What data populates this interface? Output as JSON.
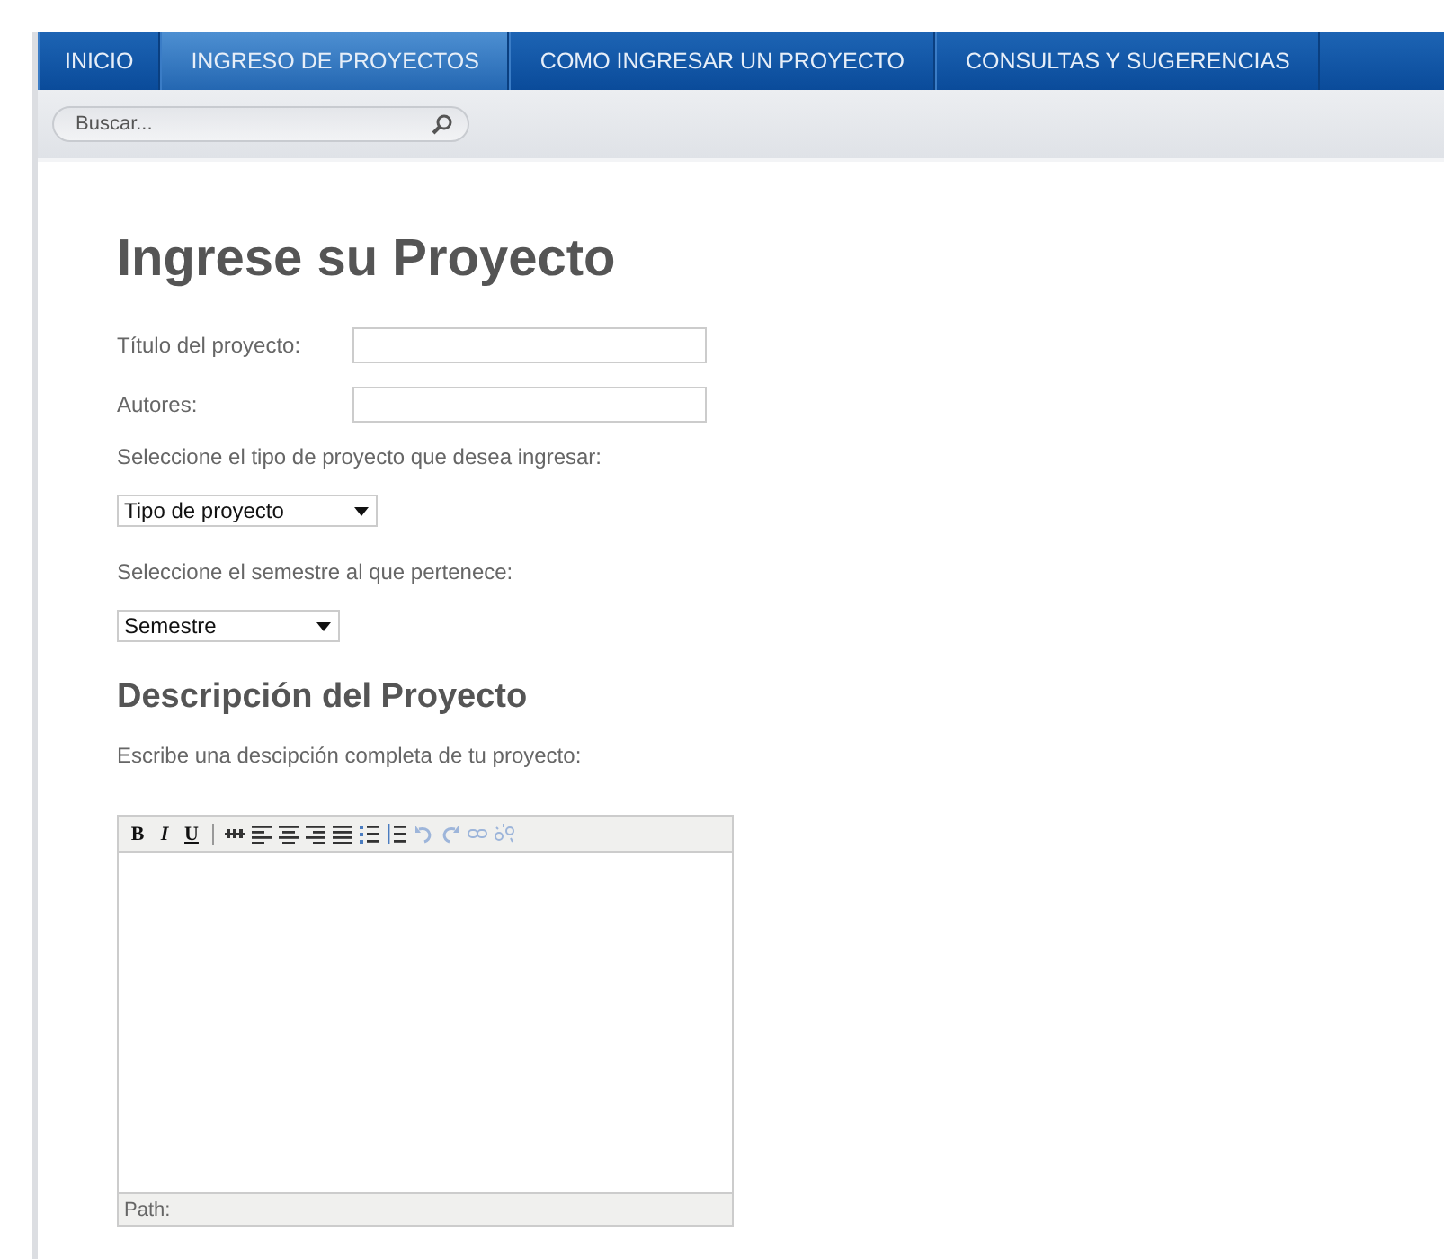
{
  "nav": {
    "items": [
      {
        "label": "INICIO",
        "selected": false
      },
      {
        "label": "INGRESO DE PROYECTOS",
        "selected": true
      },
      {
        "label": "COMO INGRESAR UN PROYECTO",
        "selected": false
      },
      {
        "label": "CONSULTAS Y SUGERENCIAS",
        "selected": false
      }
    ]
  },
  "search": {
    "placeholder": "Buscar..."
  },
  "form": {
    "title": "Ingrese su Proyecto",
    "fields": [
      {
        "label": "Título del proyecto:"
      },
      {
        "label": "Autores:"
      }
    ],
    "type_prompt": "Seleccione el tipo de proyecto que desea ingresar:",
    "type_select": {
      "value": "Tipo de proyecto"
    },
    "semester_prompt": "Seleccione el semestre al que pertenece:",
    "semester_select": {
      "value": "Semestre"
    },
    "description_title": "Descripción del Proyecto",
    "description_prompt": "Escribe una descipción completa de tu proyecto:",
    "editor": {
      "tools": [
        {
          "kind": "bold",
          "label": "B",
          "disabled": false
        },
        {
          "kind": "italic",
          "label": "I",
          "disabled": false
        },
        {
          "kind": "underline",
          "label": "U",
          "disabled": false
        },
        {
          "kind": "separator"
        },
        {
          "kind": "strike",
          "disabled": false
        },
        {
          "kind": "align-left",
          "disabled": false
        },
        {
          "kind": "align-center",
          "disabled": false
        },
        {
          "kind": "align-right",
          "disabled": false
        },
        {
          "kind": "justify",
          "disabled": false
        },
        {
          "kind": "bullets",
          "disabled": false
        },
        {
          "kind": "numbers",
          "disabled": false
        },
        {
          "kind": "undo",
          "disabled": true
        },
        {
          "kind": "redo",
          "disabled": true
        },
        {
          "kind": "link",
          "disabled": true
        },
        {
          "kind": "unlink",
          "disabled": true
        }
      ],
      "path_label": "Path:"
    }
  }
}
